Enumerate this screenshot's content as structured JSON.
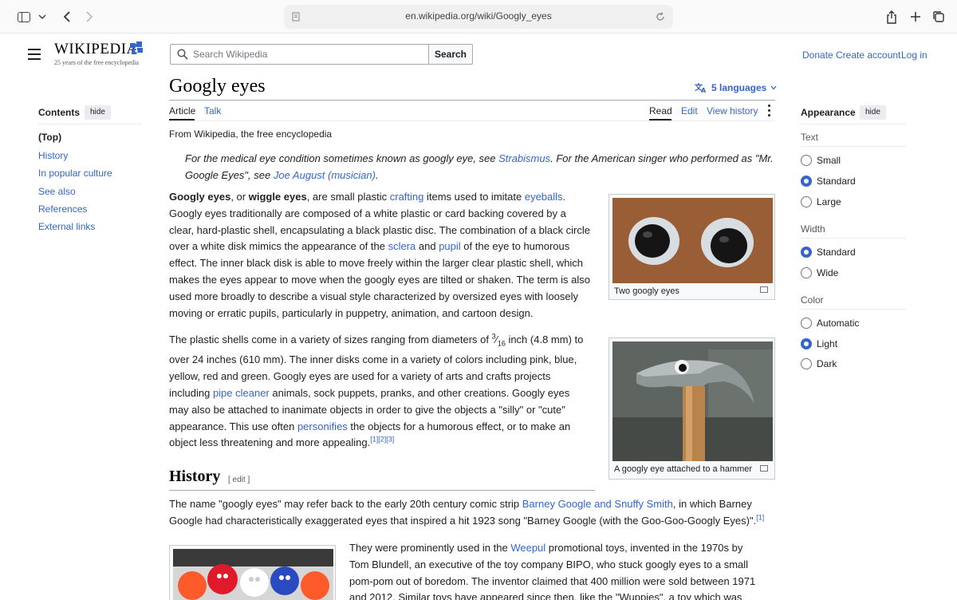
{
  "browser": {
    "url": "en.wikipedia.org/wiki/Googly_eyes"
  },
  "header": {
    "logo_word": "WIKIPEDIA",
    "logo_tagline": "25 years of the free encyclopedia",
    "search_placeholder": "Search Wikipedia",
    "search_button": "Search",
    "links": [
      "Donate",
      "Create account",
      "Log in"
    ]
  },
  "page": {
    "title": "Googly eyes",
    "languages": "5 languages",
    "tabs_left": [
      "Article",
      "Talk"
    ],
    "tabs_right": [
      "Read",
      "Edit",
      "View history"
    ],
    "from": "From Wikipedia, the free encyclopedia"
  },
  "toc": {
    "heading": "Contents",
    "hide": "hide",
    "items": [
      "(Top)",
      "History",
      "In popular culture",
      "See also",
      "References",
      "External links"
    ]
  },
  "appearance": {
    "heading": "Appearance",
    "hide": "hide",
    "text_label": "Text",
    "text_options": [
      "Small",
      "Standard",
      "Large"
    ],
    "text_selected": "Standard",
    "width_label": "Width",
    "width_options": [
      "Standard",
      "Wide"
    ],
    "width_selected": "Standard",
    "color_label": "Color",
    "color_options": [
      "Automatic",
      "Light",
      "Dark"
    ],
    "color_selected": "Light"
  },
  "article": {
    "hatnote": {
      "t1": "For the medical eye condition sometimes known as googly eye, see ",
      "l1": "Strabismus",
      "t2": ". For the American singer who performed as \"Mr. Google Eyes\", see ",
      "l2": "Joe August (musician)",
      "t3": "."
    },
    "p1": {
      "b1": "Googly eyes",
      "t1": ", or ",
      "b2": "wiggle eyes",
      "t2": ", are small plastic ",
      "l1": "crafting",
      "t3": " items used to imitate ",
      "l2": "eyeballs",
      "t4": ". Googly eyes traditionally are composed of a white plastic or card backing covered by a clear, hard-plastic shell, encapsulating a black plastic disc. The combination of a black circle over a white disk mimics the appearance of the ",
      "l3": "sclera",
      "t5": " and ",
      "l4": "pupil",
      "t6": " of the eye to humorous effect. The inner black disk is able to move freely within the larger clear plastic shell, which makes the eyes appear to move when the googly eyes are tilted or shaken. The term is also used more broadly to describe a visual style characterized by oversized eyes with loosely moving or erratic pupils, particularly in puppetry, animation, and cartoon design."
    },
    "p2": {
      "t1": "The plastic shells come in a variety of sizes ranging from diameters of ",
      "num": "3",
      "den": "16",
      "t2": " inch (4.8 mm) to over 24 inches (610 mm). The inner disks come in a variety of colors including pink, blue, yellow, red and green. Googly eyes are used for a variety of arts and crafts projects including ",
      "l1": "pipe cleaner",
      "t3": " animals, sock puppets, pranks, and other creations. Googly eyes may also be attached to inanimate objects in order to give the objects a \"silly\" or \"cute\" appearance. This use often ",
      "l2": "personifies",
      "t4": " the objects for a humorous effect, or to make an object less threatening and more appealing.",
      "refs": "[1][2][3]"
    },
    "history_heading": "History",
    "edit": "[ edit ]",
    "p3": {
      "t1": "The name \"googly eyes\" may refer back to the early 20th century comic strip ",
      "l1": "Barney Google and Snuffy Smith",
      "t2": ", in which Barney Google had characteristically exaggerated eyes that inspired a hit 1923 song \"Barney Google (with the Goo-Goo-Googly Eyes)\".",
      "ref": "[1]"
    },
    "p4": {
      "t1": "They were prominently used in the ",
      "l1": "Weepul",
      "t2": " promotional toys, invented in the 1970s by Tom Blundell, an executive of the toy company BIPO, who stuck googly eyes to a small pom-pom out of boredom. The inventor claimed that 400 million were sold between 1971 and 2012. Similar toys have appeared since then, like the \"Wuppies\", a toy which was popular in the"
    },
    "captions": [
      "Two googly eyes",
      "A googly eye attached to a hammer"
    ]
  }
}
